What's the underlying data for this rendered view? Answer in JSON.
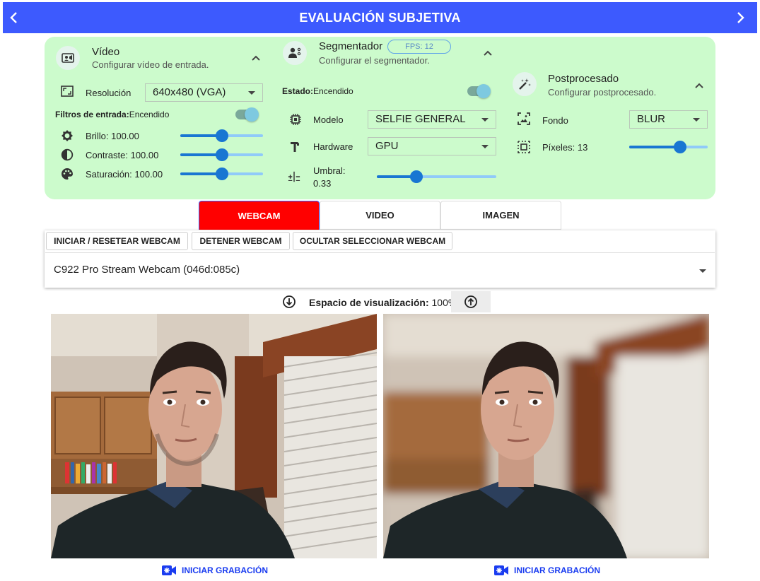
{
  "header": {
    "title": "EVALUACIÓN SUBJETIVA",
    "prev_icon": "chevron-left-icon",
    "next_icon": "chevron-right-icon",
    "bg_color": "#3d5afe"
  },
  "video": {
    "title": "Vídeo",
    "subtitle": "Configurar vídeo de entrada.",
    "resolution_label": "Resolución",
    "resolution_value": "640x480 (VGA)",
    "filters_label": "Filtros de entrada:",
    "filters_state": "Encendido",
    "filters_on": true,
    "sliders": [
      {
        "label": "Brillo: 100.00",
        "value": 100,
        "min": 0,
        "max": 200
      },
      {
        "label": "Contraste: 100.00",
        "value": 100,
        "min": 0,
        "max": 200
      },
      {
        "label": "Saturación: 100.00",
        "value": 100,
        "min": 0,
        "max": 200
      }
    ]
  },
  "segmenter": {
    "title": "Segmentador",
    "fps": "FPS: 12",
    "subtitle": "Configurar el segmentador.",
    "status_label": "Estado:",
    "status_value": "Encendido",
    "enabled": true,
    "model_label": "Modelo",
    "model_value": "SELFIE GENERAL",
    "hardware_label": "Hardware",
    "hardware_value": "GPU",
    "threshold_label": "Umbral:",
    "threshold_value_text": "0.33",
    "threshold_value": 0.33
  },
  "postprocess": {
    "title": "Postprocesado",
    "subtitle": "Configurar postprocesado.",
    "background_label": "Fondo",
    "background_value": "BLUR",
    "pixels_label": "Píxeles: 13",
    "pixels_fraction": 0.65
  },
  "tabs": [
    {
      "label": "WEBCAM",
      "active": true
    },
    {
      "label": "VIDEO",
      "active": false
    },
    {
      "label": "IMAGEN",
      "active": false
    }
  ],
  "webcam": {
    "buttons": [
      "INICIAR / RESETEAR WEBCAM",
      "DETENER WEBCAM",
      "OCULTAR SELECCIONAR WEBCAM"
    ],
    "device": "C922 Pro Stream Webcam (046d:085c)"
  },
  "display": {
    "label": "Espacio de visualización:",
    "value": "100%"
  },
  "record": {
    "left_label": "INICIAR GRABACIÓN",
    "right_label": "INICIAR GRABACIÓN"
  },
  "colors": {
    "accent": "#3d5afe",
    "panel_bg": "#ccfbcc",
    "active_tab": "#ff0000",
    "slider": "#1976d2",
    "record_text": "#1a3cf0"
  }
}
